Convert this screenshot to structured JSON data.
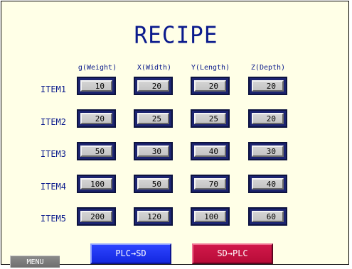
{
  "title": "RECIPE",
  "columns": [
    "g(Weight)",
    "X(Width)",
    "Y(Length)",
    "Z(Depth)"
  ],
  "rows": [
    {
      "label": "ITEM1",
      "values": [
        "10",
        "20",
        "20",
        "20"
      ]
    },
    {
      "label": "ITEM2",
      "values": [
        "20",
        "25",
        "25",
        "20"
      ]
    },
    {
      "label": "ITEM3",
      "values": [
        "50",
        "30",
        "40",
        "30"
      ]
    },
    {
      "label": "ITEM4",
      "values": [
        "100",
        "50",
        "70",
        "40"
      ]
    },
    {
      "label": "ITEM5",
      "values": [
        "200",
        "120",
        "100",
        "60"
      ]
    }
  ],
  "buttons": {
    "plc_to_sd": "PLC→SD",
    "sd_to_plc": "SD→PLC",
    "menu": "MENU"
  },
  "colors": {
    "background": "#ffffe7",
    "text": "#0a1a8c",
    "plc_button": "#1428e0",
    "sd_button": "#b80c38"
  }
}
